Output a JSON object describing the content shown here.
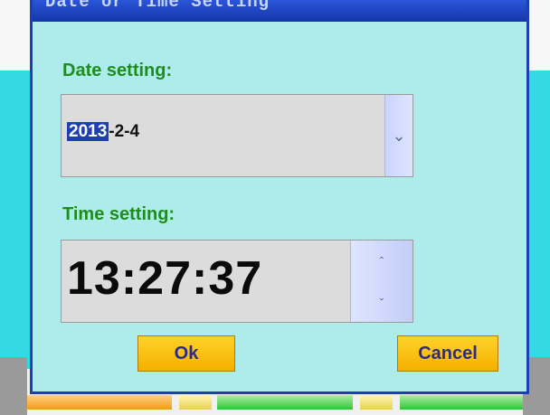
{
  "window": {
    "title": "Date or Time Setting"
  },
  "date": {
    "label": "Date setting:",
    "year": "2013",
    "rest": "-2-4",
    "dropdown_icon": "chevron-down-icon"
  },
  "time": {
    "label": "Time setting:",
    "value": "13:27:37",
    "up_icon": "chevron-up-icon",
    "down_icon": "chevron-down-icon"
  },
  "buttons": {
    "ok_label": "Ok",
    "cancel_label": "Cancel"
  },
  "colors": {
    "dialog_bg": "#aeeceb",
    "label_green": "#1e8d1e",
    "button_yellow": "#f5b000",
    "title_blue": "#1536a8"
  }
}
